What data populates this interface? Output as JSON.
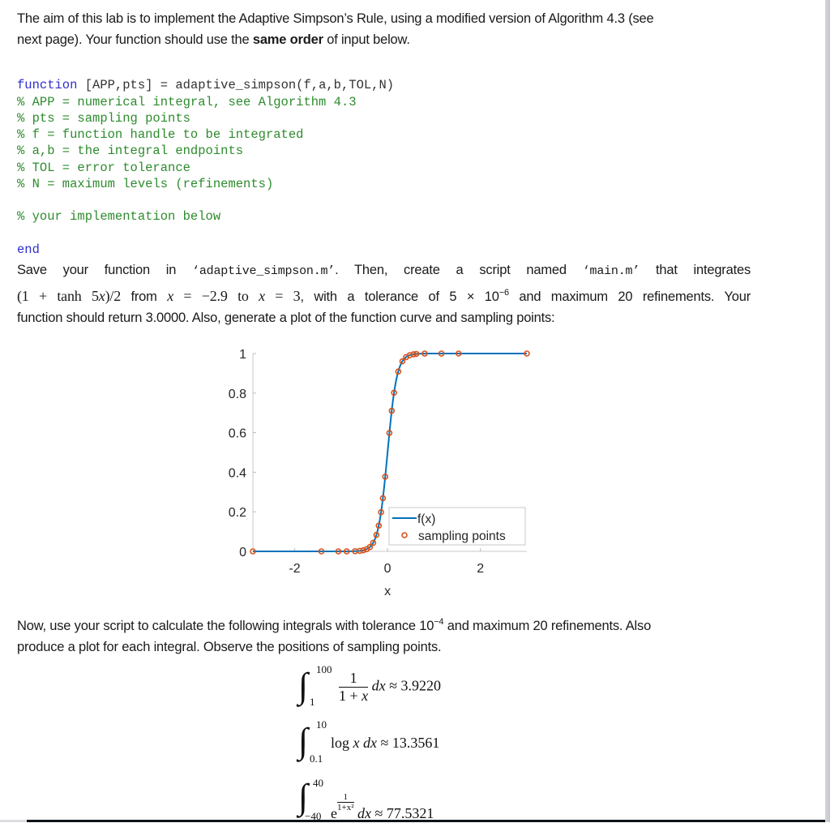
{
  "intro": {
    "line1": "The aim of this lab is to implement the Adaptive Simpson’s Rule, using a modified version of Algorithm 4.3 (see",
    "line2_pre": "next page). Your function should use the ",
    "line2_bold": "same order",
    "line2_post": " of input below."
  },
  "code": {
    "signature_kw": "function",
    "signature_rest": " [APP,pts] = adaptive_simpson(f,a,b,TOL,N)",
    "comments": [
      "% APP = numerical integral, see Algorithm 4.3",
      "% pts = sampling points",
      "% f = function handle to be integrated",
      "% a,b = the integral endpoints",
      "% TOL = error tolerance",
      "% N = maximum levels (refinements)"
    ],
    "impl_comment": "% your implementation below",
    "end_kw": "end"
  },
  "task": {
    "l1_a": "Save your function in ",
    "l1_file1": "‘adaptive_simpson.m’",
    "l1_b": ". Then, create a script named ",
    "l1_file2": "‘main.m’",
    "l1_c": " that integrates",
    "l2_expr": "(1 + tanh 5",
    "l2_x": "x",
    "l2_expr2": ")/2",
    "l2_from": " from ",
    "l2_eq1": " = −2.9 to ",
    "l2_eq2": " = 3",
    "l2_tol": ", with a tolerance of 5 × 10",
    "l2_exp": "−6",
    "l2_rest": " and maximum 20 refinements. Your",
    "l3": "function should return 3.0000. Also, generate a plot of the function curve and sampling points:"
  },
  "chart_data": {
    "type": "line",
    "title": "",
    "xlabel": "x",
    "ylabel": "",
    "xlim": [
      -2.9,
      3.0
    ],
    "ylim": [
      0,
      1
    ],
    "xticks": [
      -2,
      0,
      2
    ],
    "xtick_labels": [
      "-2",
      "0",
      "2"
    ],
    "yticks": [
      0,
      0.2,
      0.4,
      0.6,
      0.8,
      1
    ],
    "ytick_labels": [
      "0",
      "0.2",
      "0.4",
      "0.6",
      "0.8",
      "1"
    ],
    "grid": false,
    "legend": {
      "position": "bottom-right",
      "entries": [
        "f(x)",
        "sampling points"
      ]
    },
    "function": "(1+tanh(5x))/2",
    "series": [
      {
        "name": "f(x)",
        "style": "line",
        "color": "#0072bd"
      },
      {
        "name": "sampling points",
        "style": "markers-circle",
        "color": "#d95319",
        "x": [
          -2.9,
          -1.425,
          -1.06,
          -0.88,
          -0.7,
          -0.6,
          -0.52,
          -0.45,
          -0.38,
          -0.31,
          -0.24,
          -0.19,
          -0.14,
          -0.1,
          -0.05,
          0.04,
          0.09,
          0.14,
          0.23,
          0.32,
          0.4,
          0.48,
          0.56,
          0.62,
          0.8,
          1.16,
          1.53,
          3.0
        ]
      }
    ]
  },
  "now": {
    "l1_a": "Now, use your script to calculate the following integrals with tolerance 10",
    "l1_exp": "−4",
    "l1_b": " and maximum 20 refinements. Also",
    "l2": "produce a plot for each integral. Observe the positions of sampling points."
  },
  "integrals": [
    {
      "upper": "100",
      "lower": "1",
      "num": "1",
      "den": "1 + ",
      "den_x": "x",
      "dx": "dx",
      "approx": "≈ 3.9220"
    },
    {
      "upper": "10",
      "lower": "0.1",
      "body_pre": "log ",
      "body_x": "x",
      "dx": "dx",
      "approx": "≈ 13.3561"
    },
    {
      "upper": "40",
      "lower": "−40",
      "base": "e",
      "exp_num": "1",
      "exp_den": "1+x²",
      "dx": "dx",
      "approx": "≈ 77.5321"
    }
  ]
}
